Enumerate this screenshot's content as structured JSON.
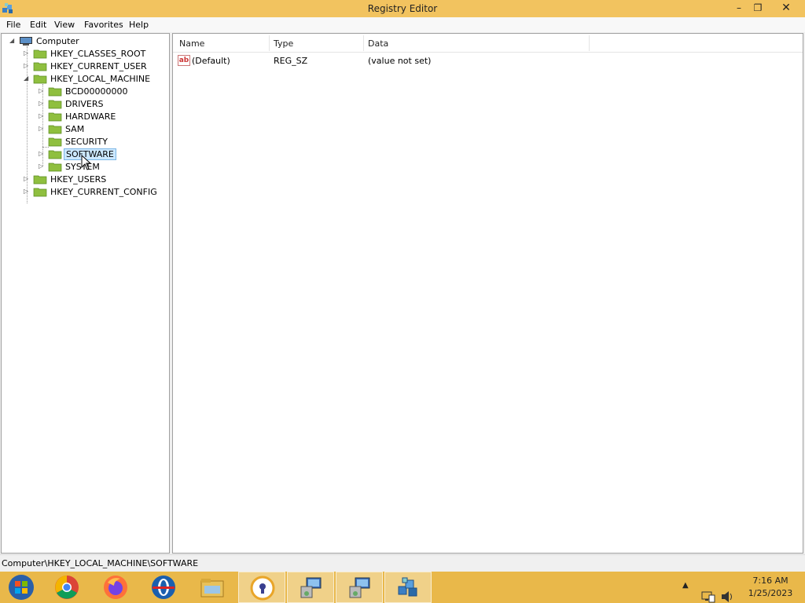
{
  "window": {
    "title": "Registry Editor",
    "minimize": "–",
    "maximize": "❐",
    "close": "✕"
  },
  "menu": {
    "file": "File",
    "edit": "Edit",
    "view": "View",
    "favorites": "Favorites",
    "help": "Help"
  },
  "tree": {
    "root": "Computer",
    "hkcr": "HKEY_CLASSES_ROOT",
    "hkcu": "HKEY_CURRENT_USER",
    "hklm": "HKEY_LOCAL_MACHINE",
    "bcd": "BCD00000000",
    "drivers": "DRIVERS",
    "hardware": "HARDWARE",
    "sam": "SAM",
    "security": "SECURITY",
    "software": "SOFTWARE",
    "system": "SYSTEM",
    "hku": "HKEY_USERS",
    "hkcc": "HKEY_CURRENT_CONFIG"
  },
  "list": {
    "headers": {
      "name": "Name",
      "type": "Type",
      "data": "Data"
    },
    "rows": [
      {
        "name": "(Default)",
        "type": "REG_SZ",
        "data": "(value not set)"
      }
    ]
  },
  "status": {
    "path": "Computer\\HKEY_LOCAL_MACHINE\\SOFTWARE"
  },
  "taskbar": {
    "items": [
      "start-icon",
      "chrome-icon",
      "firefox-icon",
      "opera-icon",
      "file-explorer-icon",
      "vpn-shield-icon",
      "remote-desktop-icon",
      "remote-desktop-icon",
      "registry-editor-icon"
    ],
    "time": "7:16 AM",
    "date": "1/25/2023"
  },
  "colors": {
    "titlebar": "#f2c35f",
    "taskbar": "#e9b84a",
    "selection": "#cce8ff",
    "folder": "#8fbf3f"
  }
}
